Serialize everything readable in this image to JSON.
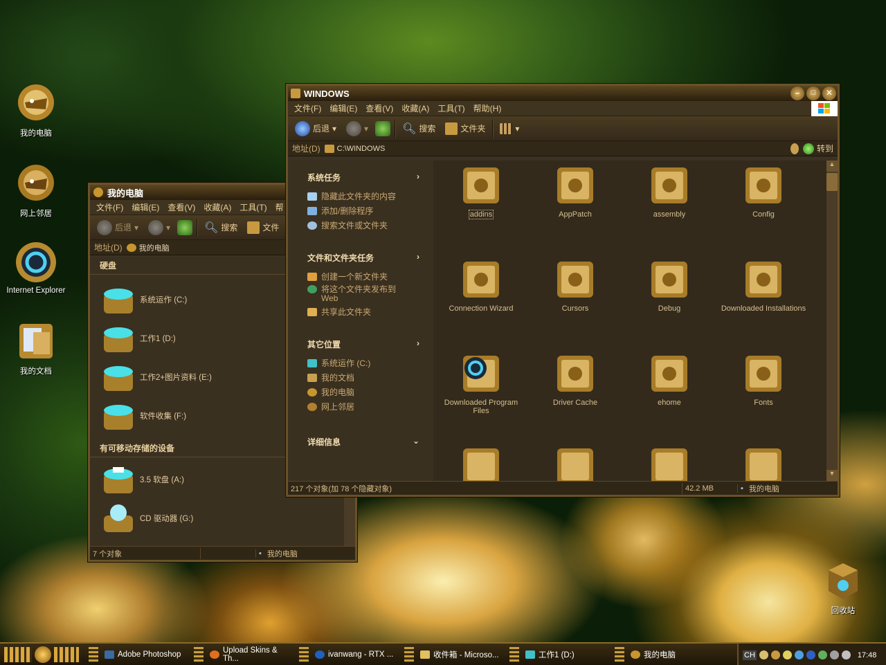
{
  "desktop": {
    "icons": [
      "我的电脑",
      "网上邻居",
      "Internet Explorer",
      "我的文档",
      "回收站"
    ]
  },
  "mycomputer": {
    "title": "我的电脑",
    "menu": [
      "文件(F)",
      "编辑(E)",
      "查看(V)",
      "收藏(A)",
      "工具(T)",
      "帮"
    ],
    "toolbar": {
      "back": "后退",
      "search": "搜索",
      "folders": "文件"
    },
    "address_label": "地址(D)",
    "address_value": "我的电脑",
    "section_hdd": "硬盘",
    "drives": [
      "系统运作 (C:)",
      "工作1 (D:)",
      "工作2+图片资料 (E:)",
      "软件收集 (F:)"
    ],
    "section_removable": "有可移动存储的设备",
    "removable": [
      "3.5 软盘 (A:)",
      "CD 驱动器 (G:)"
    ],
    "status_count": "7 个对象",
    "status_loc": "我的电脑"
  },
  "windows": {
    "title": "WINDOWS",
    "menu": [
      "文件(F)",
      "编辑(E)",
      "查看(V)",
      "收藏(A)",
      "工具(T)",
      "帮助(H)"
    ],
    "toolbar": {
      "back": "后退",
      "search": "搜索",
      "folders": "文件夹"
    },
    "address_label": "地址(D)",
    "address_value": "C:\\WINDOWS",
    "go": "转到",
    "tasks": {
      "system_title": "系统任务",
      "system": [
        "隐藏此文件夹的内容",
        "添加/删除程序",
        "搜索文件或文件夹"
      ],
      "file_title": "文件和文件夹任务",
      "file": [
        "创建一个新文件夹",
        "将这个文件夹发布到\nWeb",
        "共享此文件夹"
      ],
      "other_title": "其它位置",
      "other": [
        "系统运作 (C:)",
        "我的文档",
        "我的电脑",
        "网上邻居"
      ],
      "details_title": "详细信息"
    },
    "folders": [
      "addins",
      "AppPatch",
      "assembly",
      "Config",
      "Connection Wizard",
      "Cursors",
      "Debug",
      "Downloaded Installations",
      "Downloaded Program Files",
      "Driver Cache",
      "ehome",
      "Fonts"
    ],
    "status_count": "217 个对象(加 78 个隐藏对象)",
    "status_size": "42.2 MB",
    "status_loc": "我的电脑"
  },
  "taskbar": {
    "items": [
      "Adobe Photoshop",
      "Upload Skins & Th...",
      "ivanwang - RTX ...",
      "收件箱 - Microso...",
      "工作1 (D:)",
      "我的电脑"
    ],
    "tray_lang": "CH",
    "clock": "17:48"
  }
}
